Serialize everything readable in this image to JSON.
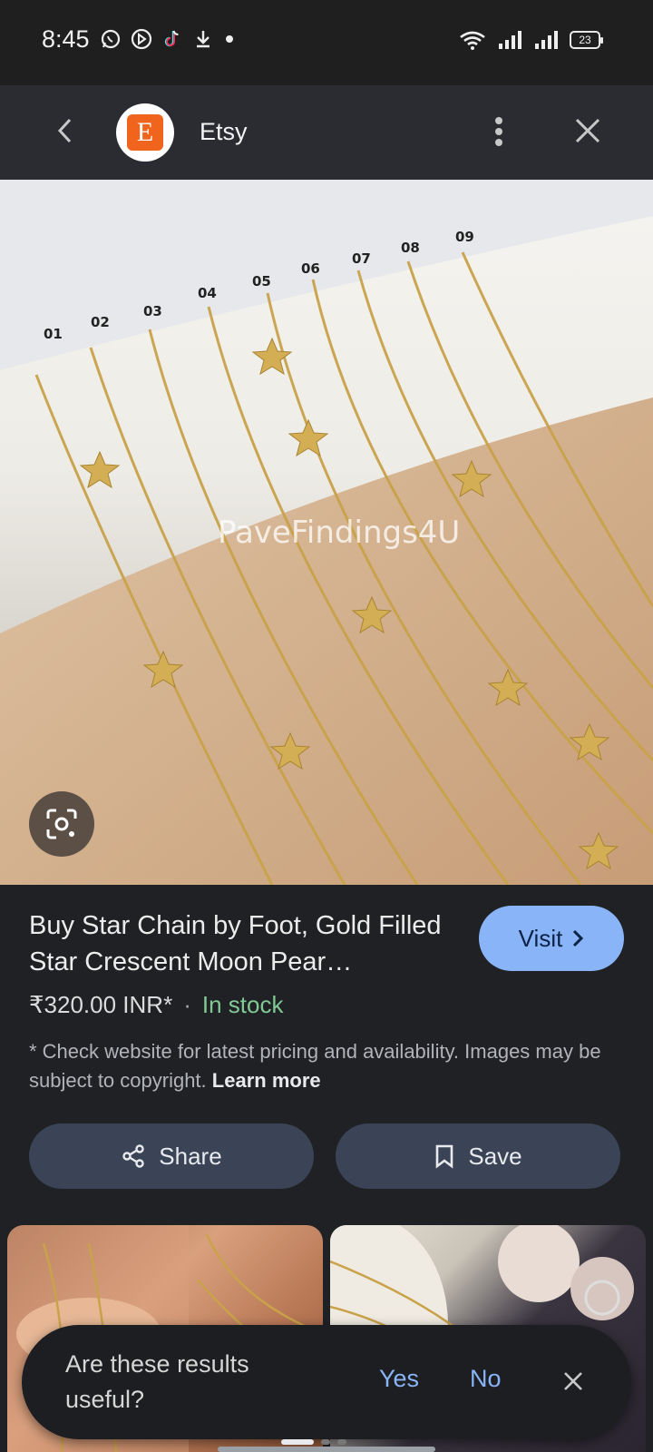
{
  "status_bar": {
    "time": "8:45",
    "left_icons": [
      "whatsapp-icon",
      "play-store-icon",
      "tiktok-icon",
      "download-icon",
      "dot-icon"
    ],
    "right_icons": [
      "wifi-icon",
      "signal-icon",
      "signal-icon"
    ],
    "battery": "23"
  },
  "header": {
    "logo_letter": "E",
    "site_name": "Etsy",
    "accent": "#f1641e"
  },
  "image": {
    "watermark": "PaveFindings4U",
    "labels": [
      "01",
      "02",
      "03",
      "04",
      "05",
      "06",
      "07",
      "08",
      "09"
    ]
  },
  "product": {
    "title": "Buy Star Chain by Foot, Gold Filled Star Crescent Moon Pear…",
    "visit_label": "Visit",
    "price": "₹320.00 INR*",
    "separator": "·",
    "stock": "In stock",
    "disclaimer": "* Check website for latest pricing and availability. Images may be subject to copyright.",
    "learn_more": "Learn more"
  },
  "actions": {
    "share_label": "Share",
    "save_label": "Save"
  },
  "feedback": {
    "question": "Are these results useful?",
    "yes_label": "Yes",
    "no_label": "No"
  },
  "colors": {
    "background": "#202124",
    "visit_button": "#8ab4f8",
    "action_button": "#3a4456",
    "stock": "#81c995"
  }
}
